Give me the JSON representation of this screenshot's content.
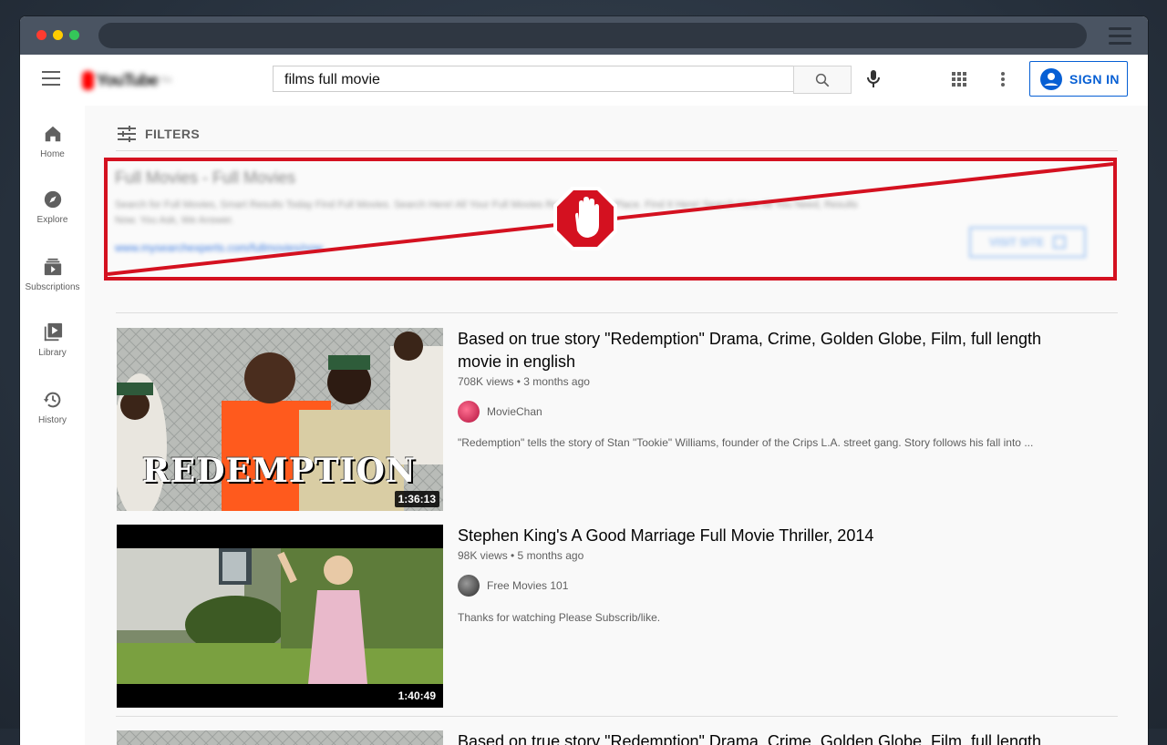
{
  "browser": {
    "address": ""
  },
  "header": {
    "logo_text": "YouTube",
    "logo_sup": "TH",
    "search_value": "films full movie",
    "signin_label": "SIGN IN"
  },
  "sidebar": {
    "items": [
      {
        "label": "Home",
        "icon": "home-icon"
      },
      {
        "label": "Explore",
        "icon": "compass-icon"
      },
      {
        "label": "Subscriptions",
        "icon": "subscriptions-icon"
      },
      {
        "label": "Library",
        "icon": "library-icon"
      },
      {
        "label": "History",
        "icon": "history-icon"
      }
    ]
  },
  "filters": {
    "label": "FILTERS"
  },
  "ad": {
    "title": "Full Movies - Full Movies",
    "description": "Search for Full Movies, Smart Results Today Find Full Movies. Search Here! All Your Full Movies Results in One Place. Find It Here! Search Here All You Need, Results Now. You Ask, We Answer.",
    "url": "www.mysearchexperts.com/fullmovies/now",
    "visit_label": "VISIT SITE",
    "blocked_color": "#d41120"
  },
  "videos": [
    {
      "title": "Based on true story \"Redemption\" Drama, Crime, Golden Globe, Film, full length movie in english",
      "meta": "708K views • 3 months ago",
      "channel": "MovieChan",
      "description": "\"Redemption\" tells the story of Stan \"Tookie\" Williams, founder of the Crips L.A. street gang. Story follows his fall into ...",
      "duration": "1:36:13",
      "thumb_text": "REDEMPTION"
    },
    {
      "title": "Stephen King's A Good Marriage Full Movie Thriller, 2014",
      "meta": "98K views • 5 months ago",
      "channel": "Free Movies 101",
      "description": "Thanks for watching Please Subscrib/like.",
      "duration": "1:40:49"
    },
    {
      "title": "Based on true story \"Redemption\" Drama, Crime, Golden Globe, Film, full length"
    }
  ]
}
